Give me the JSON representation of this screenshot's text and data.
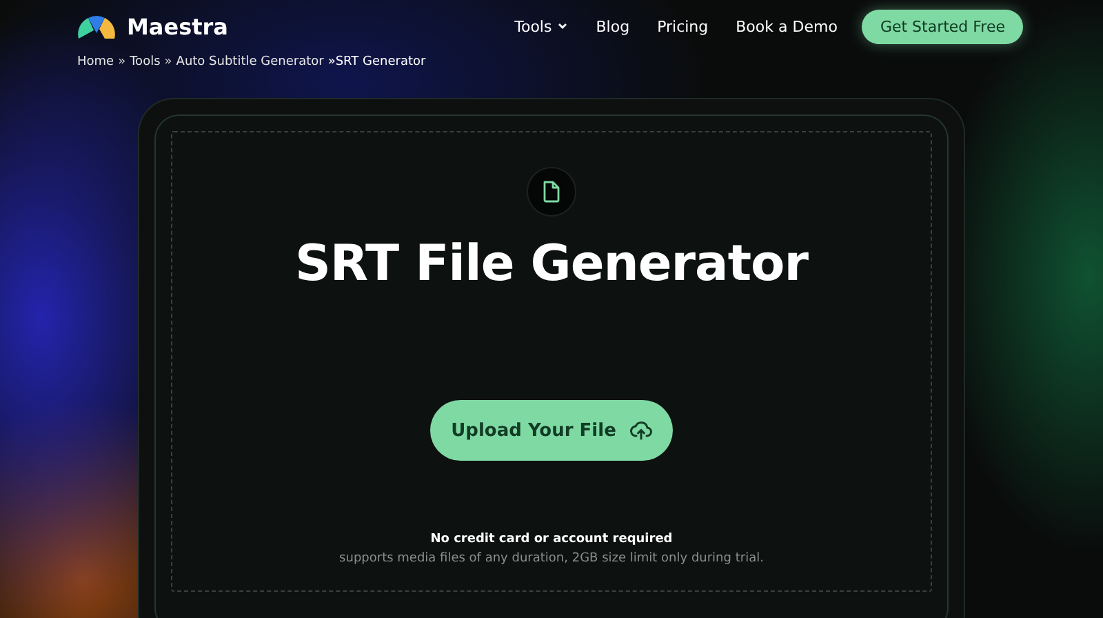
{
  "header": {
    "brand": "Maestra",
    "nav": [
      {
        "label": "Tools",
        "kind": "dropdown"
      },
      {
        "label": "Blog",
        "kind": "link"
      },
      {
        "label": "Pricing",
        "kind": "link"
      },
      {
        "label": "Book a Demo",
        "kind": "link"
      }
    ],
    "cta": "Get Started Free"
  },
  "breadcrumb": [
    {
      "label": "Home",
      "kind": "link"
    },
    {
      "label": "»",
      "kind": "separator"
    },
    {
      "label": "Tools",
      "kind": "link"
    },
    {
      "label": "»",
      "kind": "separator"
    },
    {
      "label": "Auto Subtitle Generator",
      "kind": "link"
    },
    {
      "label": "»SRT Generator",
      "kind": "current"
    }
  ],
  "uploader": {
    "title": "SRT File Generator",
    "button": "Upload Your File",
    "note": "No credit card or account required",
    "subnote": "supports media files of any duration, 2GB size limit only during trial."
  }
}
